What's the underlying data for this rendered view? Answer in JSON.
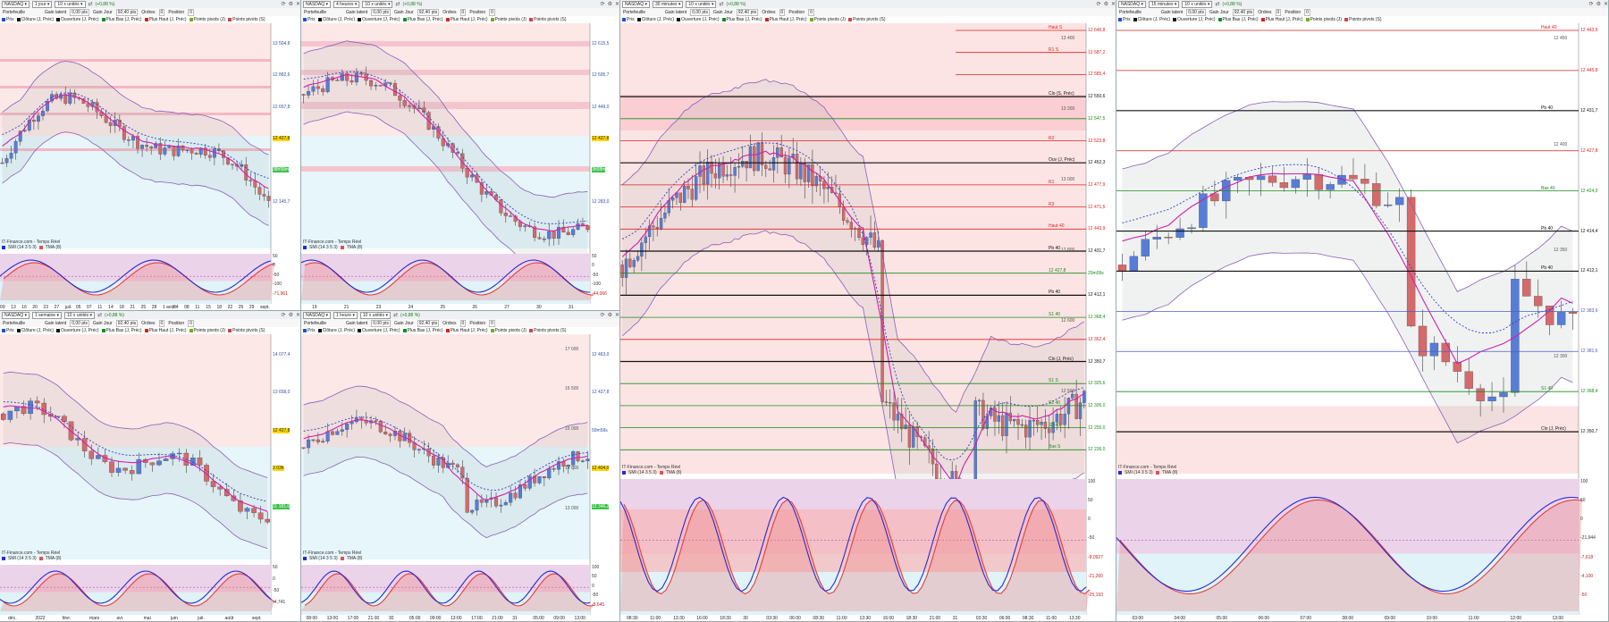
{
  "common": {
    "symbol": "NASDAQ",
    "units": "10 x unités",
    "portfolio": "Portefeuille",
    "latent_label": "Gain latent",
    "latent_value": "0,00 pts",
    "jour_label": "Gain Jour",
    "jour_value": "92,40 pts",
    "orders_label": "Ordres",
    "orders_value": "0",
    "position_label": "Position",
    "position_value": "0",
    "legend_items": [
      "Prix",
      "Clôture (J, Préc)",
      "Ouverture (J, Préc)",
      "Plus Bas (J, Préc)",
      "Plus Haut (J, Préc)",
      "Points pivots (J)",
      "Points pivots (S)"
    ],
    "source": "IT-Finance.com - Temps Réel",
    "stoch_legend": [
      "SMI (14 3 5 3)",
      "TMA (8)"
    ]
  },
  "panels": [
    {
      "id": "daily",
      "period": "1 jour",
      "change": "(+0,88 %)",
      "xticks": [
        "09",
        "13",
        "16",
        "20",
        "23",
        "27",
        "juil.",
        "05",
        "07",
        "11",
        "14",
        "18",
        "21",
        "25",
        "28",
        "1 août",
        "04",
        "08",
        "11",
        "15",
        "18",
        "22",
        "25",
        "29",
        "sept."
      ],
      "price_labels": [
        "13 504,8",
        "12 882,6",
        "12 657,8",
        "12 427,8",
        "38h58m",
        "12 145,7"
      ],
      "osc_labels": [
        "50",
        "0",
        "-50",
        "-100",
        "-71,961"
      ]
    },
    {
      "id": "h4",
      "period": "4 heures",
      "change": "(+0,88 %)",
      "xticks": [
        "19",
        "21",
        "23",
        "24",
        "25",
        "26",
        "27",
        "30",
        "31"
      ],
      "price_labels": [
        "12 615,5",
        "12 595,7",
        "12 449,0",
        "12 427,8",
        "3h58m",
        "12 283,0"
      ],
      "osc_labels": [
        "50",
        "0",
        "-50",
        "-100",
        "-44,066"
      ]
    },
    {
      "id": "m30",
      "period": "30 minutes",
      "change": "(+0,88 %)",
      "xticks": [
        "08:30",
        "11:00",
        "13:30",
        "16:00",
        "18:30",
        "30",
        "03:30",
        "06:00",
        "08:30",
        "11:00",
        "13:30",
        "16:00",
        "18:30",
        "21:00",
        "31",
        "03:30",
        "06:00",
        "08:30",
        "11:00",
        "13:30"
      ],
      "y_ticks": [
        "13 400",
        "13 200",
        "13 000",
        "12 800",
        "12 600",
        "12 500"
      ],
      "pivots": [
        {
          "name": "Haut S",
          "value": "12 646,8",
          "kind": "red"
        },
        {
          "name": "R1 S",
          "value": "12 587,2",
          "kind": "red"
        },
        {
          "name": "",
          "value": "12 585,4",
          "kind": "red"
        },
        {
          "name": "Clo (S, Préc)",
          "value": "12 550,6",
          "kind": "black"
        },
        {
          "name": "",
          "value": "12 547,5",
          "kind": "grn"
        },
        {
          "name": "R2",
          "value": "12 523,8",
          "kind": "red"
        },
        {
          "name": "Ouv (J, Préc)",
          "value": "12 452,3",
          "kind": "black"
        },
        {
          "name": "R1",
          "value": "12 477,9",
          "kind": "red"
        },
        {
          "name": "R3",
          "value": "12 471,5",
          "kind": "red"
        },
        {
          "name": "Haut 40",
          "value": "12 443,9",
          "kind": "red"
        },
        {
          "name": "Pb 40",
          "value": "12 431,7",
          "kind": "black"
        },
        {
          "name": "12 427,8",
          "value": "20m09s",
          "kind": "grn"
        },
        {
          "name": "Pb 40",
          "value": "12 412,1",
          "kind": "black"
        },
        {
          "name": "S1 40",
          "value": "12 368,4",
          "kind": "grn"
        },
        {
          "name": "",
          "value": "12 362,4",
          "kind": "red"
        },
        {
          "name": "Clo (J, Préc)",
          "value": "12 350,7",
          "kind": "black"
        },
        {
          "name": "S1 S",
          "value": "12 325,6",
          "kind": "grn"
        },
        {
          "name": "S2 40",
          "value": "12 305,0",
          "kind": "grn"
        },
        {
          "name": "S3 40",
          "value": "12 255,0",
          "kind": "grn"
        },
        {
          "name": "Bas S",
          "value": "12 236,0",
          "kind": "grn"
        }
      ],
      "osc_labels": [
        "100",
        "50",
        "0",
        "-50",
        "-8,0927",
        "-21,260",
        "-25,193"
      ]
    },
    {
      "id": "m15",
      "period": "15 minutes",
      "change": "(+0,88 %)",
      "xticks": [
        "03:00",
        "04:00",
        "05:00",
        "06:00",
        "07:00",
        "08:00",
        "09:00",
        "10:00",
        "11:00",
        "12:00",
        "13:00"
      ],
      "y_ticks": [
        "12 450",
        "12 400",
        "12 350",
        "12 300"
      ],
      "pivots": [
        {
          "name": "Haut 40",
          "value": "12 443,9",
          "kind": "red"
        },
        {
          "name": "",
          "value": "12 445,8",
          "kind": "red"
        },
        {
          "name": "Pb 40",
          "value": "12 431,7",
          "kind": "black"
        },
        {
          "name": "",
          "value": "12 427,8",
          "kind": "red"
        },
        {
          "name": "Bas 40",
          "value": "12 424,0",
          "kind": "grn"
        },
        {
          "name": "Pb 40",
          "value": "12 414,4",
          "kind": "black"
        },
        {
          "name": "Pb 40",
          "value": "12 412,1",
          "kind": "black"
        },
        {
          "name": "",
          "value": "12 383,6",
          "kind": "blue"
        },
        {
          "name": "",
          "value": "12 381,6",
          "kind": "blue"
        },
        {
          "name": "S1 40",
          "value": "12 368,4",
          "kind": "grn"
        },
        {
          "name": "Clo (J, Préc)",
          "value": "12 350,7",
          "kind": "black"
        }
      ],
      "osc_labels": [
        "100",
        "50",
        "0",
        "-21,944",
        "-7,618",
        "-4,100",
        "-50"
      ]
    },
    {
      "id": "weekly",
      "period": "1 semaine",
      "change": "(+0,88 %)",
      "xticks": [
        "déc.",
        "2022",
        "févr.",
        "mars",
        "avr.",
        "mai",
        "juin",
        "juil.",
        "août",
        "sept."
      ],
      "price_labels": [
        "14 077,4",
        "13 658,0",
        "12 427,8",
        "2 03h",
        "11 181,6"
      ],
      "osc_labels": [
        "50",
        "0",
        "-50",
        "-4,741"
      ]
    },
    {
      "id": "h1",
      "period": "1 heure",
      "change": "(+0,88 %)",
      "xticks": [
        "08:00",
        "13:00",
        "17:00",
        "21:00",
        "30",
        "05:00",
        "09:00",
        "13:00",
        "17:00",
        "21:00",
        "31",
        "05:00",
        "09:00",
        "13:00"
      ],
      "y_ticks": [
        "17 000",
        "16 500",
        "15 000",
        "14 000",
        "13 000"
      ],
      "price_labels": [
        "12 463,0",
        "12 427,8",
        "59m59s",
        "12 404,0",
        "12 346,2"
      ],
      "osc_labels": [
        "100",
        "50",
        "0",
        "-50",
        "-8,645"
      ]
    }
  ]
}
